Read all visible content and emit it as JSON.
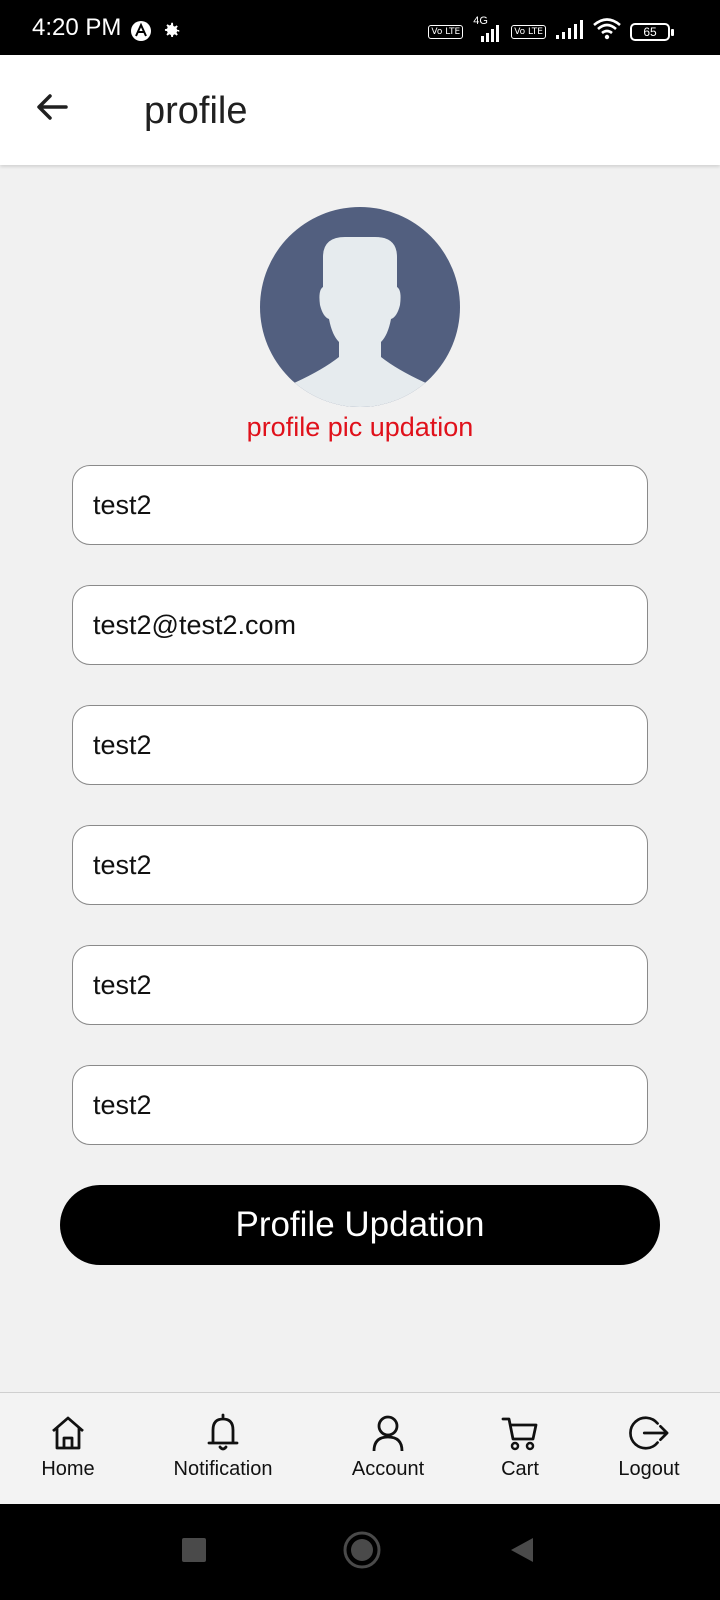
{
  "status_bar": {
    "time": "4:20 PM",
    "battery": "65",
    "badge_1": "Vo LTE",
    "badge_2": "Vo LTE",
    "network": "4G"
  },
  "header": {
    "title": "profile"
  },
  "avatar": {
    "caption": "profile pic updation"
  },
  "form": {
    "fields": [
      {
        "value": "test2"
      },
      {
        "value": "test2@test2.com"
      },
      {
        "value": "test2"
      },
      {
        "value": "test2"
      },
      {
        "value": "test2"
      },
      {
        "value": "test2"
      }
    ],
    "submit_label": "Profile Updation"
  },
  "bottom_nav": {
    "items": [
      {
        "label": "Home",
        "icon": "home-icon"
      },
      {
        "label": "Notification",
        "icon": "bell-icon"
      },
      {
        "label": "Account",
        "icon": "user-icon"
      },
      {
        "label": "Cart",
        "icon": "cart-icon"
      },
      {
        "label": "Logout",
        "icon": "logout-icon"
      }
    ]
  },
  "colors": {
    "accent_red": "#e0111b",
    "avatar_bg": "#525f7f",
    "button_bg": "#000000"
  }
}
